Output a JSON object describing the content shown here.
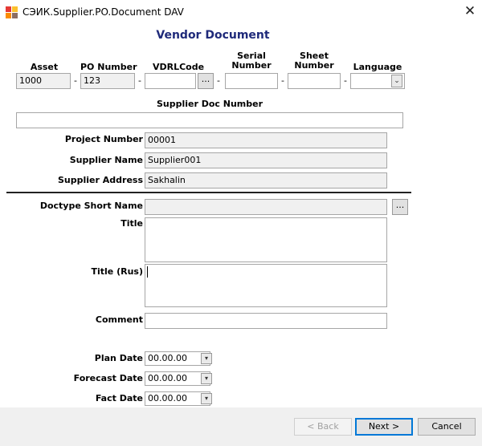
{
  "window": {
    "title": "СЭИК.Supplier.PO.Document  DAV",
    "close_glyph": "✕",
    "icon": "app-puzzle-icon"
  },
  "form": {
    "header": "Vendor Document",
    "asset": {
      "label": "Asset",
      "value": "1000"
    },
    "po_number": {
      "label": "PO Number",
      "value": "123"
    },
    "vdrl_code": {
      "label": "VDRLCode",
      "value": "",
      "browse_label": "..."
    },
    "serial_number": {
      "label_line1": "Serial",
      "label_line2": "Number",
      "value": ""
    },
    "sheet_number": {
      "label_line1": "Sheet",
      "label_line2": "Number",
      "value": ""
    },
    "language": {
      "label": "Language",
      "value": "",
      "arrow": "⌄"
    },
    "dash": "-",
    "supplier_doc_number": {
      "label": "Supplier Doc Number",
      "value": ""
    },
    "project_number": {
      "label": "Project Number",
      "value": "00001"
    },
    "supplier_name": {
      "label": "Supplier Name",
      "value": "Supplier001"
    },
    "supplier_address": {
      "label": "Supplier Address",
      "value": "Sakhalin"
    },
    "doctype_short_name": {
      "label": "Doctype Short Name",
      "value": "",
      "browse_label": "..."
    },
    "title": {
      "label": "Title",
      "value": ""
    },
    "title_rus": {
      "label": "Title (Rus)",
      "value": ""
    },
    "comment": {
      "label": "Comment",
      "value": ""
    },
    "plan_date": {
      "label": "Plan Date",
      "value": "00.00.00"
    },
    "forecast_date": {
      "label": "Forecast Date",
      "value": "00.00.00"
    },
    "fact_date": {
      "label": "Fact Date",
      "value": "00.00.00"
    },
    "date_arrow": "▾"
  },
  "buttons": {
    "back": "< Back",
    "next": "Next >",
    "cancel": "Cancel"
  }
}
